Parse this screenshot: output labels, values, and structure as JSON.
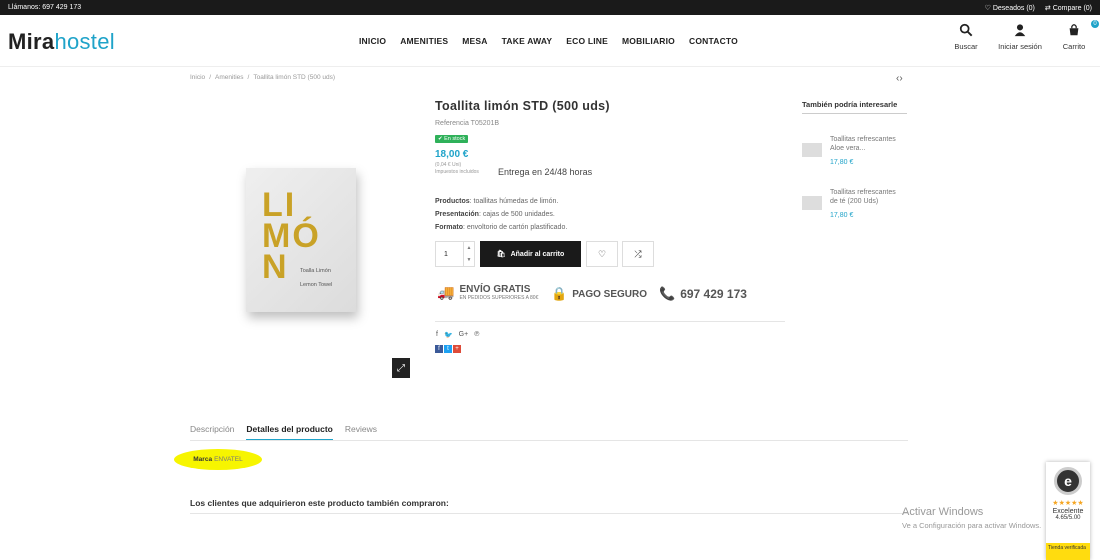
{
  "topbar": {
    "phone": "Llámanos: 697 429 173",
    "wishlist": "Deseados (0)",
    "compare": "Compare (0)"
  },
  "logo": {
    "bold": "Mira",
    "light": "hostel"
  },
  "nav": [
    "INICIO",
    "AMENITIES",
    "MESA",
    "TAKE AWAY",
    "ECO LINE",
    "MOBILIARIO",
    "CONTACTO"
  ],
  "header_icons": {
    "search": "Buscar",
    "login": "Iniciar sesión",
    "cart": "Carrito",
    "cart_count": "0"
  },
  "breadcrumb": [
    "Inicio",
    "Amenities",
    "Toallita limón STD (500 uds)"
  ],
  "product": {
    "title": "Toallita limón STD (500 uds)",
    "reference": "Referencia T05201B",
    "stock": "En stock",
    "price": "18,00 €",
    "unit_price": "(0,04 € Uni)",
    "tax": "Impuestos incluidos",
    "delivery": "Entrega en 24/48 horas",
    "image_text": {
      "line1": "LI",
      "line2": "MÓ",
      "line3": "N",
      "name1": "Toalla Limón",
      "name2": "Lemon Towel"
    },
    "details": [
      {
        "label": "Productos",
        "value": ": toallitas húmedas de limón."
      },
      {
        "label": "Presentación",
        "value": ": cajas de 500 unidades."
      },
      {
        "label": "Formato",
        "value": ": envoltorio de cartón plastificado."
      }
    ],
    "quantity": "1",
    "add_to_cart": "Añadir al carrito"
  },
  "trust": {
    "shipping": "ENVÍO GRATIS",
    "shipping_sub": "EN PEDIDOS SUPERIORES A 80€",
    "secure": "PAGO SEGURO",
    "phone": "697 429 173"
  },
  "sidebar": {
    "title": "También podría interesarle",
    "items": [
      {
        "name": "Toallitas refrescantes Aloe vera...",
        "price": "17,80 €"
      },
      {
        "name": "Toallitas refrescantes de té (200 Uds)",
        "price": "17,80 €"
      }
    ]
  },
  "tabs": [
    "Descripción",
    "Detalles del producto",
    "Reviews"
  ],
  "marca": {
    "label": "Marca",
    "value": "ENVATEL"
  },
  "also_bought": "Los clientes que adquirieron este producto también compraron:",
  "windows": {
    "line1": "Activar Windows",
    "line2": "Ve a Configuración para activar Windows."
  },
  "trusted": {
    "rating_word": "Excelente",
    "score": "4.65/5.00",
    "footer": "Tienda verificada",
    "seal": "e"
  },
  "colors": {
    "accent": "#1fa3c9",
    "stock": "#2fb15a",
    "highlight": "#f7f500"
  }
}
